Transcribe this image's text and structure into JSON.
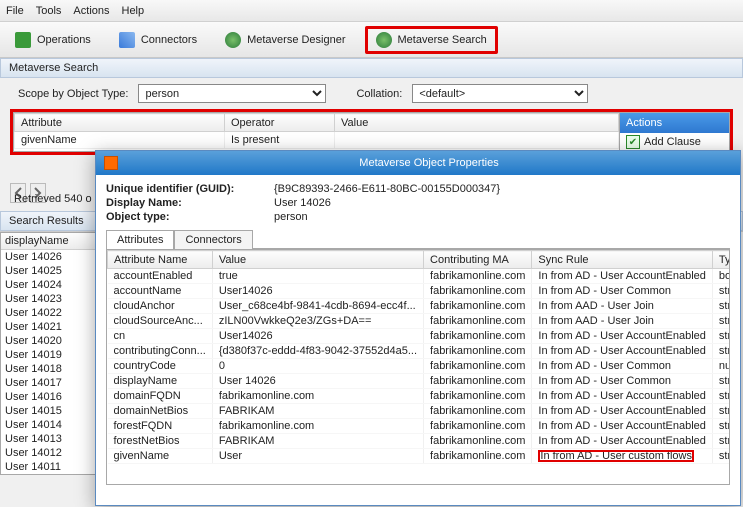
{
  "menu": {
    "file": "File",
    "tools": "Tools",
    "actions": "Actions",
    "help": "Help"
  },
  "toolbar": {
    "operations": "Operations",
    "connectors": "Connectors",
    "designer": "Metaverse Designer",
    "search": "Metaverse Search"
  },
  "section": {
    "mvSearch": "Metaverse Search"
  },
  "scope": {
    "label": "Scope by Object Type:",
    "value": "person",
    "collationLabel": "Collation:",
    "collationValue": "<default>"
  },
  "criteria": {
    "headers": {
      "attribute": "Attribute",
      "operator": "Operator",
      "value": "Value"
    },
    "row": {
      "attribute": "givenName",
      "operator": "Is present",
      "value": ""
    },
    "actionsHeader": "Actions",
    "addClause": "Add Clause"
  },
  "retrieved": "Retrieved 540 o",
  "searchResults": {
    "title": "Search Results",
    "col": "displayName",
    "items": [
      "User 14026",
      "User 14025",
      "User 14024",
      "User 14023",
      "User 14022",
      "User 14021",
      "User 14020",
      "User 14019",
      "User 14018",
      "User 14017",
      "User 14016",
      "User 14015",
      "User 14014",
      "User 14013",
      "User 14012",
      "User 14011"
    ]
  },
  "props": {
    "title": "Metaverse Object Properties",
    "guidLabel": "Unique identifier (GUID):",
    "guid": "{B9C89393-2466-E611-80BC-00155D000347}",
    "dispLabel": "Display Name:",
    "disp": "User 14026",
    "typeLabel": "Object type:",
    "type": "person",
    "tabs": {
      "attributes": "Attributes",
      "connectors": "Connectors"
    },
    "headers": {
      "name": "Attribute Name",
      "value": "Value",
      "ma": "Contributing MA",
      "rule": "Sync Rule",
      "type": "Type"
    },
    "rows": [
      {
        "n": "accountEnabled",
        "v": "true",
        "m": "fabrikamonline.com",
        "r": "In from AD - User AccountEnabled",
        "t": "boolean"
      },
      {
        "n": "accountName",
        "v": "User14026",
        "m": "fabrikamonline.com",
        "r": "In from AD - User Common",
        "t": "string"
      },
      {
        "n": "cloudAnchor",
        "v": "User_c68ce4bf-9841-4cdb-8694-ecc4f...",
        "m": "fabrikamonline.com",
        "r": "In from AAD - User Join",
        "t": "string"
      },
      {
        "n": "cloudSourceAnc...",
        "v": "zILN00VwkkeQ2e3/ZGs+DA==",
        "m": "fabrikamonline.com",
        "r": "In from AAD - User Join",
        "t": "string"
      },
      {
        "n": "cn",
        "v": "User14026",
        "m": "fabrikamonline.com",
        "r": "In from AD - User AccountEnabled",
        "t": "string"
      },
      {
        "n": "contributingConn...",
        "v": "{d380f37c-eddd-4f83-9042-37552d4a5...",
        "m": "fabrikamonline.com",
        "r": "In from AD - User AccountEnabled",
        "t": "string"
      },
      {
        "n": "countryCode",
        "v": "0",
        "m": "fabrikamonline.com",
        "r": "In from AD - User Common",
        "t": "number"
      },
      {
        "n": "displayName",
        "v": "User 14026",
        "m": "fabrikamonline.com",
        "r": "In from AD - User Common",
        "t": "string"
      },
      {
        "n": "domainFQDN",
        "v": "fabrikamonline.com",
        "m": "fabrikamonline.com",
        "r": "In from AD - User AccountEnabled",
        "t": "string"
      },
      {
        "n": "domainNetBios",
        "v": "FABRIKAM",
        "m": "fabrikamonline.com",
        "r": "In from AD - User AccountEnabled",
        "t": "string"
      },
      {
        "n": "forestFQDN",
        "v": "fabrikamonline.com",
        "m": "fabrikamonline.com",
        "r": "In from AD - User AccountEnabled",
        "t": "string"
      },
      {
        "n": "forestNetBios",
        "v": "FABRIKAM",
        "m": "fabrikamonline.com",
        "r": "In from AD - User AccountEnabled",
        "t": "string"
      },
      {
        "n": "givenName",
        "v": "User",
        "m": "fabrikamonline.com",
        "r": "In from AD - User custom flows",
        "t": "string",
        "hl": true
      }
    ]
  }
}
